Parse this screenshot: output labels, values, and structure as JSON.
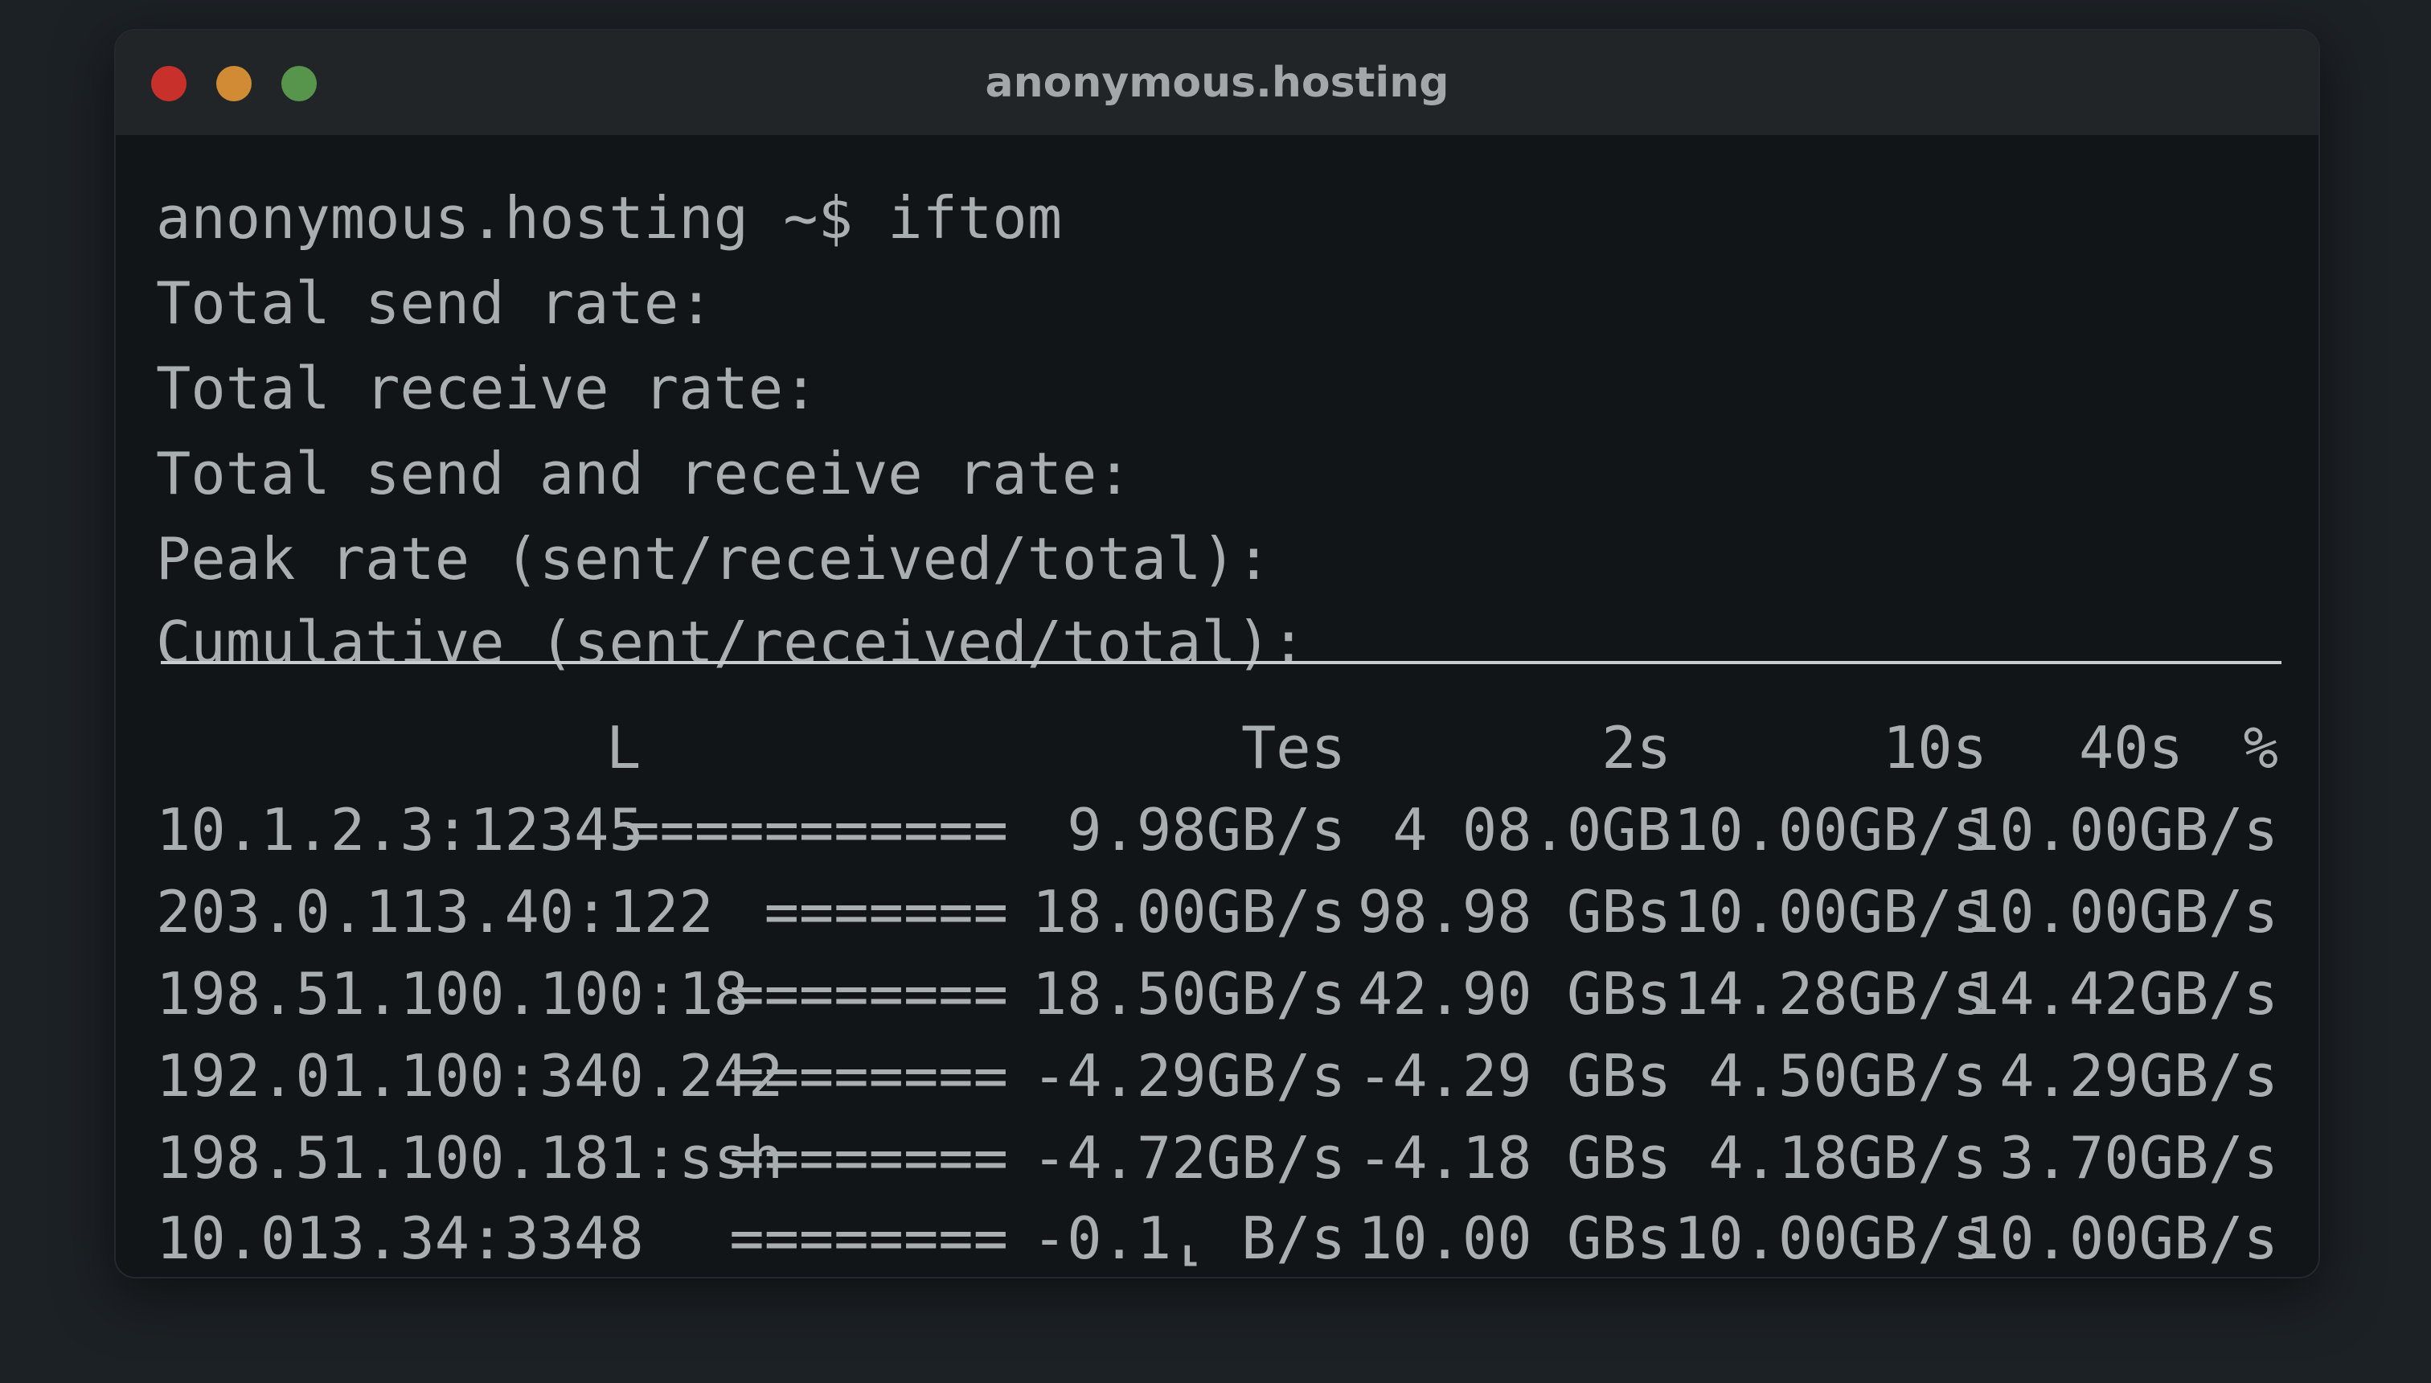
{
  "window": {
    "title": "anonymous.hosting",
    "traffic_lights": [
      {
        "name": "close",
        "color": "#c8302b"
      },
      {
        "name": "minimize",
        "color": "#d18b34"
      },
      {
        "name": "zoom",
        "color": "#57954d"
      }
    ]
  },
  "terminal": {
    "prompt": "anonymous.hosting ~$ iftom",
    "summary": [
      "Total send rate:",
      "Total receive rate:",
      "Total send and receive rate:",
      "Peak rate (sent/received/total):",
      "Cumulative (sent/received/total):"
    ],
    "header": {
      "host": "L",
      "c1": "Tes",
      "c2": "2s",
      "c3": "10s",
      "c4": "40s",
      "c5": "%"
    },
    "rows": [
      {
        "host": "10.1.2.3:12345",
        "bar": "===========",
        "v1": "9.98GB/s",
        "v2": "4 08.0GB",
        "v3": "10.00GB/s",
        "v4": "10.00GB/s"
      },
      {
        "host": "203.0.113.40:122",
        "bar": "=======",
        "v1": "18.00GB/s",
        "v2": "98.98 GBs",
        "v3": "10.00GB/s",
        "v4": "10.00GB/s"
      },
      {
        "host": "198.51.100.100:18",
        "bar": "========",
        "v1": "18.50GB/s",
        "v2": "42.90 GBs",
        "v3": "14.28GB/s",
        "v4": "14.42GB/s"
      },
      {
        "host": "192.01.100:340.242",
        "bar": "========",
        "v1": "-4.29GB/s",
        "v2": "-4.29 GBs",
        "v3": "4.50GB/s",
        "v4": "4.29GB/s"
      },
      {
        "host": "198.51.100.181:ssh",
        "bar": "========",
        "v1": "-4.72GB/s",
        "v2": "-4.18 GBs",
        "v3": "4.18GB/s",
        "v4": "3.70GB/s"
      },
      {
        "host": "10.013.34:3348",
        "bar": "========",
        "v1": "-0.1⸤ B/s",
        "v2": "10.00 GBs",
        "v3": "10.00GB/s",
        "v4": "10.00GB/s"
      }
    ]
  }
}
